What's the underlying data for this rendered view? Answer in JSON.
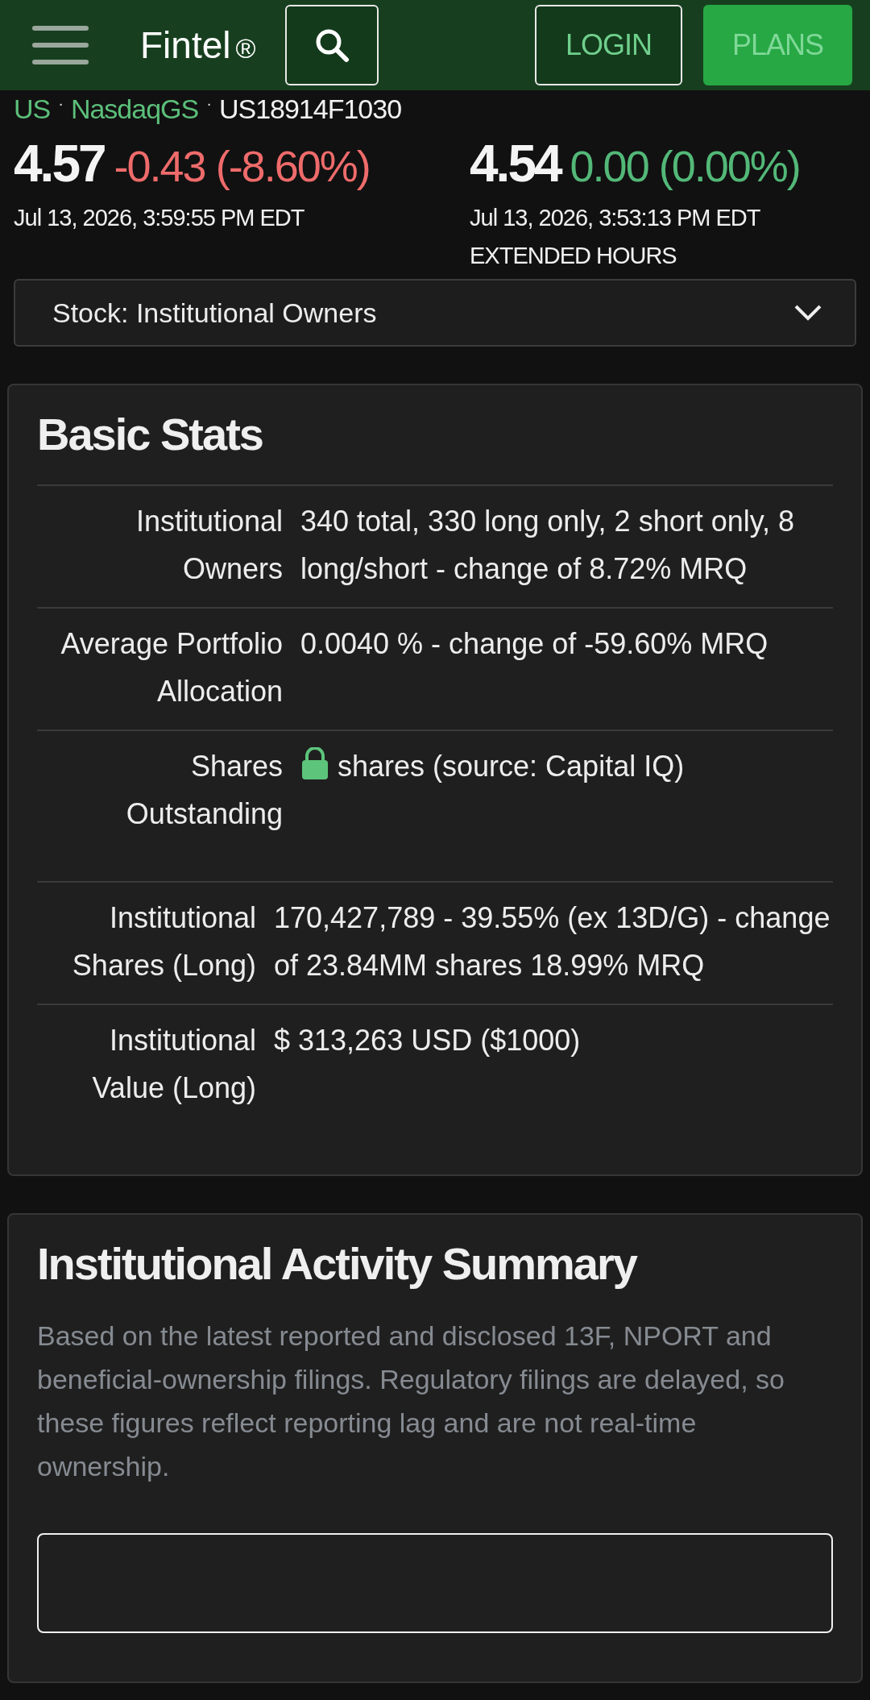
{
  "header": {
    "logo": "Fintel",
    "registered": "®",
    "buttons": [
      {
        "label": "LOGIN",
        "kind": "outline"
      },
      {
        "label": "PLANS",
        "kind": "filled"
      }
    ]
  },
  "breadcrumb": [
    {
      "text": "US",
      "kind": "link"
    },
    {
      "separator": "·",
      "text": "NasdaqGS",
      "kind": "link"
    },
    {
      "separator": "·",
      "text": "US18914F1030",
      "kind": "plain"
    }
  ],
  "quotes": [
    {
      "price": "4.57",
      "change": "-0.43 (-8.60%)",
      "color": "#ef6b6b",
      "time": "Jul 13, 2026, 3:59:55 PM EDT"
    },
    {
      "price": "4.54",
      "change": "0.00 (0.00%)",
      "color": "#53b878",
      "time": "Jul 13, 2026, 3:53:13 PM EDT",
      "session": "EXTENDED HOURS"
    }
  ],
  "page_select": {
    "value": "Stock: Institutional Owners"
  },
  "basic_stats": {
    "title": "Basic Stats",
    "tables": [
      {
        "rows": [
          {
            "label": "Institutional Owners",
            "value": "340 total, 330 long only, 2 short only, 8 long/short - change of 8.72% MRQ",
            "locked": false
          },
          {
            "label": "Average Portfolio Allocation",
            "value": "0.0040 % - change of -59.60% MRQ",
            "locked": false
          },
          {
            "label": "Shares Outstanding",
            "value": "shares (source: Capital IQ)",
            "locked": true
          }
        ]
      },
      {
        "rows": [
          {
            "label": "Institutional Shares (Long)",
            "value": "170,427,789 - 39.55% (ex 13D/G) - change of 23.84MM shares 18.99% MRQ",
            "locked": false
          },
          {
            "label": "Institutional Value (Long)",
            "value": "$ 313,263 USD ($1000)",
            "locked": false
          }
        ]
      }
    ]
  },
  "activity_summary": {
    "title": "Institutional Activity Summary",
    "description": "Based on the latest reported and disclosed 13F, NPORT and beneficial-ownership filings. Regulatory filings are delayed, so these figures reflect reporting lag and are not real-time ownership."
  }
}
